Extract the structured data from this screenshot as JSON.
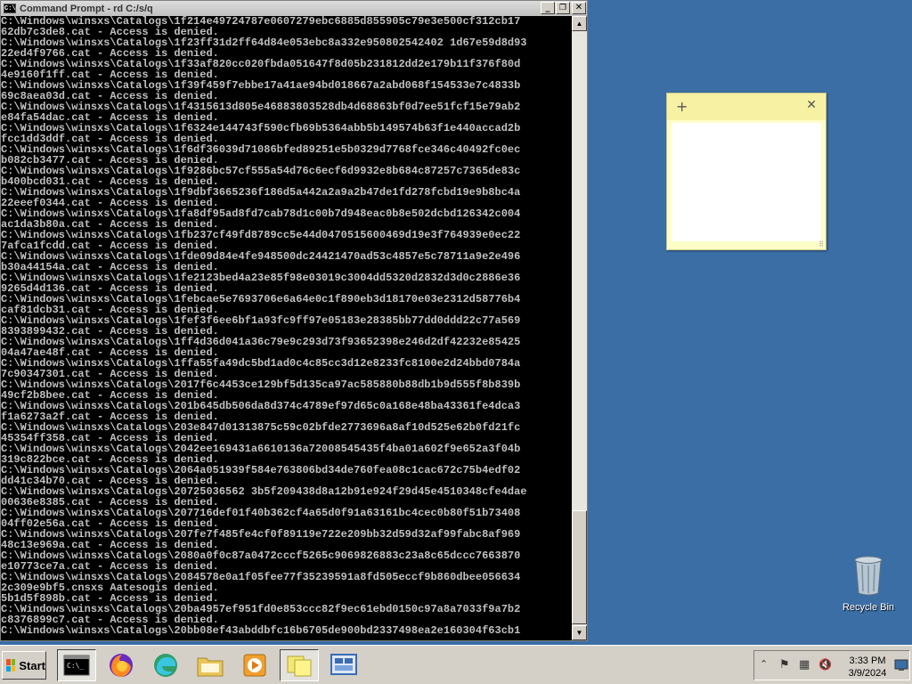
{
  "window": {
    "title": "Command Prompt - rd  C:/s/q",
    "icon_text": "C:\\",
    "minimize": "_",
    "maximize": "❐",
    "close": "✕"
  },
  "console_lines": [
    "C:\\Windows\\winsxs\\Catalogs\\1f214e49724787e0607279ebc6885d855905c79e3e500cf312cb17",
    "62db7c3de8.cat - Access is denied.",
    "C:\\Windows\\winsxs\\Catalogs\\1f23ff31d2ff64d84e053ebc8a332e950802542402 1d67e59d8d93",
    "22ed4f9766.cat - Access is denied.",
    "C:\\Windows\\winsxs\\Catalogs\\1f33af820cc020fbda051647f8d05b231812dd2e179b11f376f80d",
    "4e9160f1ff.cat - Access is denied.",
    "C:\\Windows\\winsxs\\Catalogs\\1f39f459f7ebbe17a41ae94bd018667a2abd068f154533e7c4833b",
    "69c8aea03d.cat - Access is denied.",
    "C:\\Windows\\winsxs\\Catalogs\\1f4315613d805e46883803528db4d68863bf0d7ee51fcf15e79ab2",
    "e84fa54dac.cat - Access is denied.",
    "C:\\Windows\\winsxs\\Catalogs\\1f6324e144743f590cfb69b5364abb5b149574b63f1e440accad2b",
    "fcc1dd3ddf.cat - Access is denied.",
    "C:\\Windows\\winsxs\\Catalogs\\1f6df36039d71086bfed89251e5b0329d7768fce346c40492fc0ec",
    "b082cb3477.cat - Access is denied.",
    "C:\\Windows\\winsxs\\Catalogs\\1f9286bc57cf555a54d76c6ecf6d9932e8b684c87257c7365de83c",
    "b400bcd031.cat - Access is denied.",
    "C:\\Windows\\winsxs\\Catalogs\\1f9dbf3665236f186d5a442a2a9a2b47de1fd278fcbd19e9b8bc4a",
    "22eeef0344.cat - Access is denied.",
    "C:\\Windows\\winsxs\\Catalogs\\1fa8df95ad8fd7cab78d1c00b7d948eac0b8e502dcbd126342c004",
    "ac1da3b80a.cat - Access is denied.",
    "C:\\Windows\\winsxs\\Catalogs\\1fb237cf49fd8789cc5e44d0470515600469d19e3f764939e0ec22",
    "7afca1fcdd.cat - Access is denied.",
    "C:\\Windows\\winsxs\\Catalogs\\1fde09d84e4fe948500dc24421470ad53c4857e5c78711a9e2e496",
    "b30a44154a.cat - Access is denied.",
    "C:\\Windows\\winsxs\\Catalogs\\1fe2123bed4a23e85f98e03019c3004dd5320d2832d3d0c2886e36",
    "9265d4d136.cat - Access is denied.",
    "C:\\Windows\\winsxs\\Catalogs\\1febcae5e7693706e6a64e0c1f890eb3d18170e03e2312d58776b4",
    "caf81dcb31.cat - Access is denied.",
    "C:\\Windows\\winsxs\\Catalogs\\1fef3f6ee6bf1a93fc9ff97e05183e28385bb77dd0ddd22c77a569",
    "8393899432.cat - Access is denied.",
    "C:\\Windows\\winsxs\\Catalogs\\1ff4d36d041a36c79e9c293d73f93652398e246d2df42232e85425",
    "04a47ae48f.cat - Access is denied.",
    "C:\\Windows\\winsxs\\Catalogs\\1ffa55fa49dc5bd1ad0c4c85cc3d12e8233fc8100e2d24bbd0784a",
    "7c90347301.cat - Access is denied.",
    "C:\\Windows\\winsxs\\Catalogs\\2017f6c4453ce129bf5d135ca97ac585880b88db1b9d555f8b839b",
    "49cf2b8bee.cat - Access is denied.",
    "C:\\Windows\\winsxs\\Catalogs\\201b645db506da8d374c4789ef97d65c0a168e48ba43361fe4dca3",
    "f1a6273a2f.cat - Access is denied.",
    "C:\\Windows\\winsxs\\Catalogs\\203e847d01313875c59c02bfde2773696a8af10d525e62b0fd21fc",
    "45354ff358.cat - Access is denied.",
    "C:\\Windows\\winsxs\\Catalogs\\2042ee169431a6610136a72008545435f4ba01a602f9e652a3f04b",
    "319c822bce.cat - Access is denied.",
    "C:\\Windows\\winsxs\\Catalogs\\2064a051939f584e763806bd34de760fea08c1cac672c75b4edf02",
    "dd41c34b70.cat - Access is denied.",
    "C:\\Windows\\winsxs\\Catalogs\\20725036562 3b5f209438d8a12b91e924f29d45e4510348cfe4dae",
    "00636e8385.cat - Access is denied.",
    "C:\\Windows\\winsxs\\Catalogs\\207716def01f40b362cf4a65d0f91a63161bc4cec0b80f51b73408",
    "04ff02e56a.cat - Access is denied.",
    "C:\\Windows\\winsxs\\Catalogs\\207fe7f485fe4cf0f89119e722e209bb32d59d32af99fabc8af969",
    "48c13e969a.cat - Access is denied.",
    "C:\\Windows\\winsxs\\Catalogs\\2080a0f0c87a0472cccf5265c9069826883c23a8c65dccc7663870",
    "e10773ce7a.cat - Access is denied.",
    "C:\\Windows\\winsxs\\Catalogs\\2084578e0a1f05fee77f35239591a8fd505eccf9b860dbee056634",
    "2c309e9bf5.cnsxs Aatesogis denied.",
    "5b1d5f898b.cat - Access is denied.",
    "C:\\Windows\\winsxs\\Catalogs\\20ba4957ef951fd0e853ccc82f9ec61ebd0150c97a8a7033f9a7b2",
    "c8376899c7.cat - Access is denied.",
    "C:\\Windows\\winsxs\\Catalogs\\20bb08ef43abddbfc16b6705de900bd2337498ea2e160304f63cb1"
  ],
  "sticky_note": {
    "add": "+",
    "close": "✕",
    "grip": "⠿",
    "content": ""
  },
  "recycle_bin": {
    "label": "Recycle Bin"
  },
  "taskbar": {
    "start_label": "Start",
    "items": [
      {
        "name": "cmd",
        "icon": "terminal-icon"
      },
      {
        "name": "firefox",
        "icon": "firefox-icon"
      },
      {
        "name": "edge",
        "icon": "edge-icon"
      },
      {
        "name": "explorer",
        "icon": "folder-icon"
      },
      {
        "name": "media",
        "icon": "media-player-icon"
      },
      {
        "name": "sticky",
        "icon": "sticky-notes-icon"
      },
      {
        "name": "remote",
        "icon": "network-icon"
      }
    ],
    "tray": {
      "chevron": "⌃",
      "flag": "⚑",
      "network": "▦",
      "volume": "🔇",
      "time": "3:33 PM",
      "date": "3/9/2024"
    }
  },
  "colors": {
    "desktop": "#3a6ea5",
    "console_bg": "#000000",
    "console_text": "#c0c0c0",
    "sticky_bg": "#fdfdc8"
  }
}
